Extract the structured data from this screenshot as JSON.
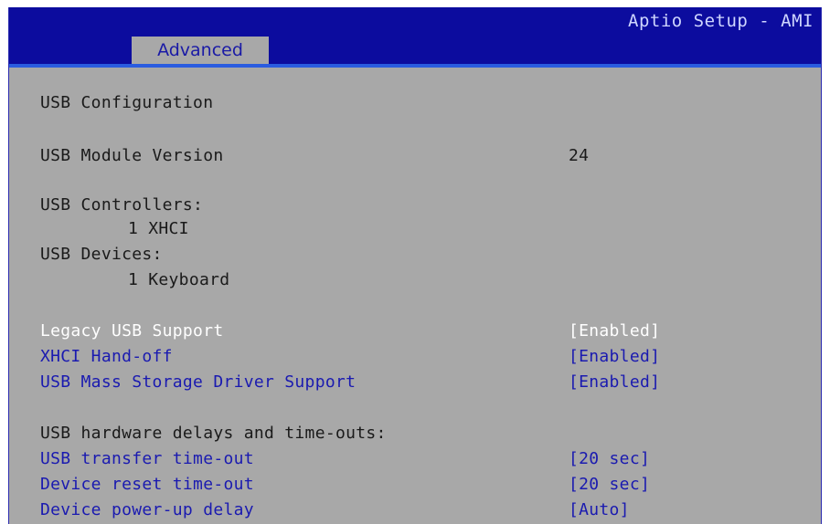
{
  "header": {
    "brand": "Aptio Setup - AMI",
    "tab": "Advanced"
  },
  "main": {
    "section_title": "USB Configuration",
    "module_version_label": "USB Module Version",
    "module_version_value": "24",
    "controllers_label": "USB Controllers:",
    "controllers_value": "1 XHCI",
    "devices_label": "USB Devices:",
    "devices_value": "1 Keyboard",
    "settings": [
      {
        "label": "Legacy USB Support",
        "value": "[Enabled]"
      },
      {
        "label": "XHCI Hand-off",
        "value": "[Enabled]"
      },
      {
        "label": "USB Mass Storage Driver Support",
        "value": "[Enabled]"
      }
    ],
    "delays_heading": "USB hardware delays and time-outs:",
    "delays": [
      {
        "label": "USB transfer time-out",
        "value": "[20 sec]"
      },
      {
        "label": "Device reset time-out",
        "value": "[20 sec]"
      },
      {
        "label": "Device power-up delay",
        "value": "[Auto]"
      }
    ]
  },
  "colors": {
    "header_bg": "#0c0c9e",
    "panel_bg": "#a8a8a8",
    "option_text": "#1a1ab0",
    "selected_text": "#ffffff"
  }
}
